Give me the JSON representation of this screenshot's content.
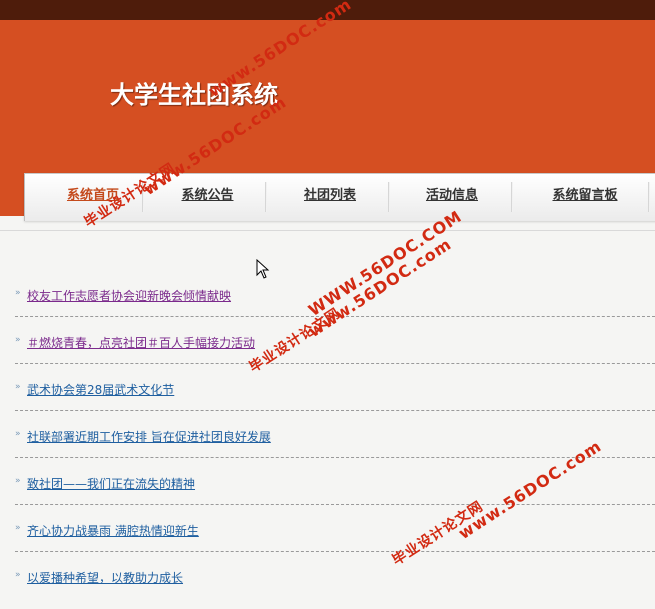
{
  "header": {
    "site_title": "大学生社团系统"
  },
  "nav": {
    "items": [
      {
        "label": "系统首页",
        "active": true
      },
      {
        "label": "系统公告",
        "active": false
      },
      {
        "label": "社团列表",
        "active": false
      },
      {
        "label": "活动信息",
        "active": false
      },
      {
        "label": "系统留言板",
        "active": false
      }
    ]
  },
  "news": {
    "items": [
      {
        "title": "校友工作志愿者协会迎新晚会倾情献映",
        "visited": true
      },
      {
        "title": "＃燃烧青春，点亮社团＃百人手幅接力活动",
        "visited": true
      },
      {
        "title": "武术协会第28届武术文化节",
        "visited": false
      },
      {
        "title": "社联部署近期工作安排 旨在促进社团良好发展",
        "visited": false
      },
      {
        "title": "致社团——我们正在流失的精神",
        "visited": false
      },
      {
        "title": "齐心协力战暴雨 满腔热情迎新生",
        "visited": false
      },
      {
        "title": "以爱播种希望，以教助力成长",
        "visited": false
      }
    ]
  },
  "watermark": {
    "cn": "毕业设计论文网",
    "url": "www.56DOC.com",
    "url_upper": "WWW.56DOC.COM"
  },
  "icons": {
    "bullet": "double-chevron-icon",
    "cursor": "mouse-pointer-icon"
  },
  "colors": {
    "banner": "#d54f22",
    "topbar": "#4e1c0b",
    "active_nav": "#c44a1c",
    "link": "#1f5fa0",
    "visited_link": "#7b2a8c",
    "watermark": "#d22a12"
  }
}
